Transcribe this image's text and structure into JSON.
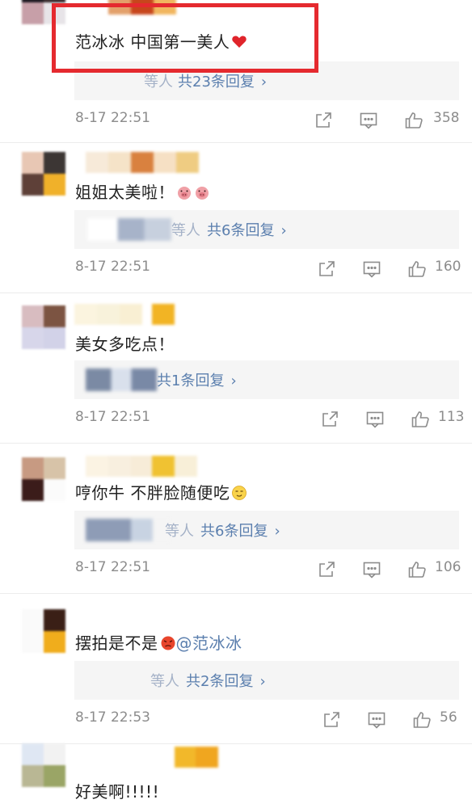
{
  "comments": [
    {
      "text": "范冰冰 中国第一美人",
      "reply": {
        "prefix": "等人",
        "label": "共23条回复",
        "chevron": "›"
      },
      "time": "8-17 22:51",
      "likes": "358",
      "emoji": "red-heart-icon"
    },
    {
      "text": "姐姐太美啦！",
      "reply": {
        "prefix": "等人",
        "label": "共6条回复",
        "chevron": "›"
      },
      "time": "8-17 22:51",
      "likes": "160",
      "emoji": "pig-face-icon"
    },
    {
      "text": "美女多吃点！",
      "reply": {
        "prefix": "",
        "label": "共1条回复",
        "chevron": "›"
      },
      "time": "8-17 22:51",
      "likes": "113"
    },
    {
      "text": "哼你牛 不胖脸随便吃",
      "reply": {
        "prefix": "等人",
        "label": "共6条回复",
        "chevron": "›"
      },
      "time": "8-17 22:51",
      "likes": "106",
      "emoji": "smirk-face-icon"
    },
    {
      "text": "摆拍是不是",
      "mention": "@范冰冰",
      "reply": {
        "prefix": "等人",
        "label": "共2条回复",
        "chevron": "›"
      },
      "time": "8-17 22:53",
      "likes": "56",
      "emoji": "angry-face-icon"
    },
    {
      "text": "好美啊!!!!!"
    }
  ],
  "colors": {
    "highlight_border": "#e52a2f",
    "link_blue": "#5b7fae",
    "meta_gray": "#8c8c8c",
    "reply_bg": "#f5f5f5"
  }
}
